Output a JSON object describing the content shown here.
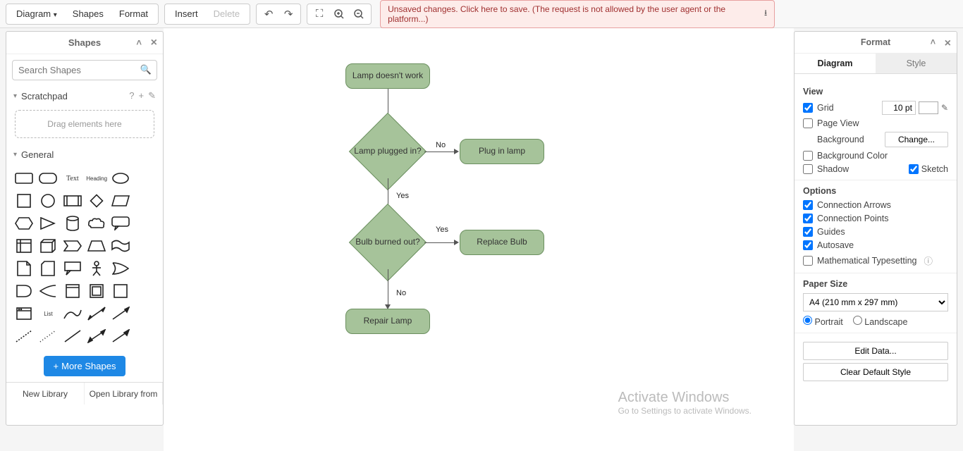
{
  "toolbar": {
    "menus": [
      "Diagram",
      "Shapes",
      "Format"
    ],
    "insert": "Insert",
    "delete": "Delete",
    "banner_text": "Unsaved changes. Click here to save. (The request is not allowed by the user agent or the platform...)"
  },
  "shapes_panel": {
    "title": "Shapes",
    "search_placeholder": "Search Shapes",
    "scratchpad_label": "Scratchpad",
    "drop_hint": "Drag elements here",
    "general_label": "General",
    "more_shapes": "More Shapes",
    "new_library": "New Library",
    "open_library": "Open Library from"
  },
  "flow": {
    "n1": "Lamp doesn't work",
    "n2": "Lamp plugged in?",
    "n3": "Plug in lamp",
    "n4": "Bulb burned out?",
    "n5": "Replace Bulb",
    "n6": "Repair Lamp",
    "lbl_no": "No",
    "lbl_yes": "Yes"
  },
  "format_panel": {
    "title": "Format",
    "tab_diagram": "Diagram",
    "tab_style": "Style",
    "view_label": "View",
    "grid": "Grid",
    "grid_value": "10 pt",
    "page_view": "Page View",
    "background": "Background",
    "change": "Change...",
    "background_color": "Background Color",
    "shadow": "Shadow",
    "sketch": "Sketch",
    "options_label": "Options",
    "conn_arrows": "Connection Arrows",
    "conn_points": "Connection Points",
    "guides": "Guides",
    "autosave": "Autosave",
    "math": "Mathematical Typesetting",
    "paper_label": "Paper Size",
    "paper_value": "A4 (210 mm x 297 mm)",
    "portrait": "Portrait",
    "landscape": "Landscape",
    "edit_data": "Edit Data...",
    "clear_default": "Clear Default Style"
  },
  "watermark": {
    "title": "Activate Windows",
    "sub": "Go to Settings to activate Windows."
  }
}
